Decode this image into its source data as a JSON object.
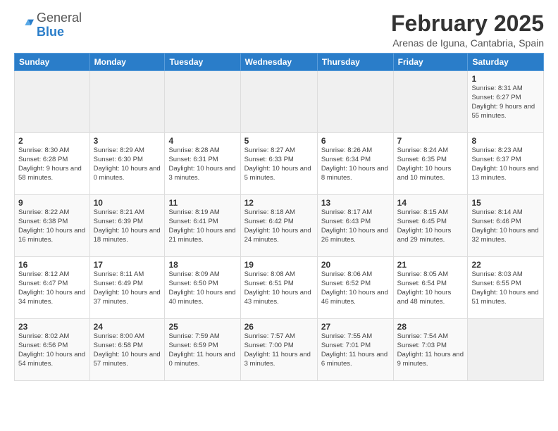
{
  "logo": {
    "general": "General",
    "blue": "Blue"
  },
  "title": "February 2025",
  "subtitle": "Arenas de Iguna, Cantabria, Spain",
  "days_of_week": [
    "Sunday",
    "Monday",
    "Tuesday",
    "Wednesday",
    "Thursday",
    "Friday",
    "Saturday"
  ],
  "weeks": [
    [
      {
        "day": "",
        "detail": ""
      },
      {
        "day": "",
        "detail": ""
      },
      {
        "day": "",
        "detail": ""
      },
      {
        "day": "",
        "detail": ""
      },
      {
        "day": "",
        "detail": ""
      },
      {
        "day": "",
        "detail": ""
      },
      {
        "day": "1",
        "detail": "Sunrise: 8:31 AM\nSunset: 6:27 PM\nDaylight: 9 hours and 55 minutes."
      }
    ],
    [
      {
        "day": "2",
        "detail": "Sunrise: 8:30 AM\nSunset: 6:28 PM\nDaylight: 9 hours and 58 minutes."
      },
      {
        "day": "3",
        "detail": "Sunrise: 8:29 AM\nSunset: 6:30 PM\nDaylight: 10 hours and 0 minutes."
      },
      {
        "day": "4",
        "detail": "Sunrise: 8:28 AM\nSunset: 6:31 PM\nDaylight: 10 hours and 3 minutes."
      },
      {
        "day": "5",
        "detail": "Sunrise: 8:27 AM\nSunset: 6:33 PM\nDaylight: 10 hours and 5 minutes."
      },
      {
        "day": "6",
        "detail": "Sunrise: 8:26 AM\nSunset: 6:34 PM\nDaylight: 10 hours and 8 minutes."
      },
      {
        "day": "7",
        "detail": "Sunrise: 8:24 AM\nSunset: 6:35 PM\nDaylight: 10 hours and 10 minutes."
      },
      {
        "day": "8",
        "detail": "Sunrise: 8:23 AM\nSunset: 6:37 PM\nDaylight: 10 hours and 13 minutes."
      }
    ],
    [
      {
        "day": "9",
        "detail": "Sunrise: 8:22 AM\nSunset: 6:38 PM\nDaylight: 10 hours and 16 minutes."
      },
      {
        "day": "10",
        "detail": "Sunrise: 8:21 AM\nSunset: 6:39 PM\nDaylight: 10 hours and 18 minutes."
      },
      {
        "day": "11",
        "detail": "Sunrise: 8:19 AM\nSunset: 6:41 PM\nDaylight: 10 hours and 21 minutes."
      },
      {
        "day": "12",
        "detail": "Sunrise: 8:18 AM\nSunset: 6:42 PM\nDaylight: 10 hours and 24 minutes."
      },
      {
        "day": "13",
        "detail": "Sunrise: 8:17 AM\nSunset: 6:43 PM\nDaylight: 10 hours and 26 minutes."
      },
      {
        "day": "14",
        "detail": "Sunrise: 8:15 AM\nSunset: 6:45 PM\nDaylight: 10 hours and 29 minutes."
      },
      {
        "day": "15",
        "detail": "Sunrise: 8:14 AM\nSunset: 6:46 PM\nDaylight: 10 hours and 32 minutes."
      }
    ],
    [
      {
        "day": "16",
        "detail": "Sunrise: 8:12 AM\nSunset: 6:47 PM\nDaylight: 10 hours and 34 minutes."
      },
      {
        "day": "17",
        "detail": "Sunrise: 8:11 AM\nSunset: 6:49 PM\nDaylight: 10 hours and 37 minutes."
      },
      {
        "day": "18",
        "detail": "Sunrise: 8:09 AM\nSunset: 6:50 PM\nDaylight: 10 hours and 40 minutes."
      },
      {
        "day": "19",
        "detail": "Sunrise: 8:08 AM\nSunset: 6:51 PM\nDaylight: 10 hours and 43 minutes."
      },
      {
        "day": "20",
        "detail": "Sunrise: 8:06 AM\nSunset: 6:52 PM\nDaylight: 10 hours and 46 minutes."
      },
      {
        "day": "21",
        "detail": "Sunrise: 8:05 AM\nSunset: 6:54 PM\nDaylight: 10 hours and 48 minutes."
      },
      {
        "day": "22",
        "detail": "Sunrise: 8:03 AM\nSunset: 6:55 PM\nDaylight: 10 hours and 51 minutes."
      }
    ],
    [
      {
        "day": "23",
        "detail": "Sunrise: 8:02 AM\nSunset: 6:56 PM\nDaylight: 10 hours and 54 minutes."
      },
      {
        "day": "24",
        "detail": "Sunrise: 8:00 AM\nSunset: 6:58 PM\nDaylight: 10 hours and 57 minutes."
      },
      {
        "day": "25",
        "detail": "Sunrise: 7:59 AM\nSunset: 6:59 PM\nDaylight: 11 hours and 0 minutes."
      },
      {
        "day": "26",
        "detail": "Sunrise: 7:57 AM\nSunset: 7:00 PM\nDaylight: 11 hours and 3 minutes."
      },
      {
        "day": "27",
        "detail": "Sunrise: 7:55 AM\nSunset: 7:01 PM\nDaylight: 11 hours and 6 minutes."
      },
      {
        "day": "28",
        "detail": "Sunrise: 7:54 AM\nSunset: 7:03 PM\nDaylight: 11 hours and 9 minutes."
      },
      {
        "day": "",
        "detail": ""
      }
    ]
  ]
}
